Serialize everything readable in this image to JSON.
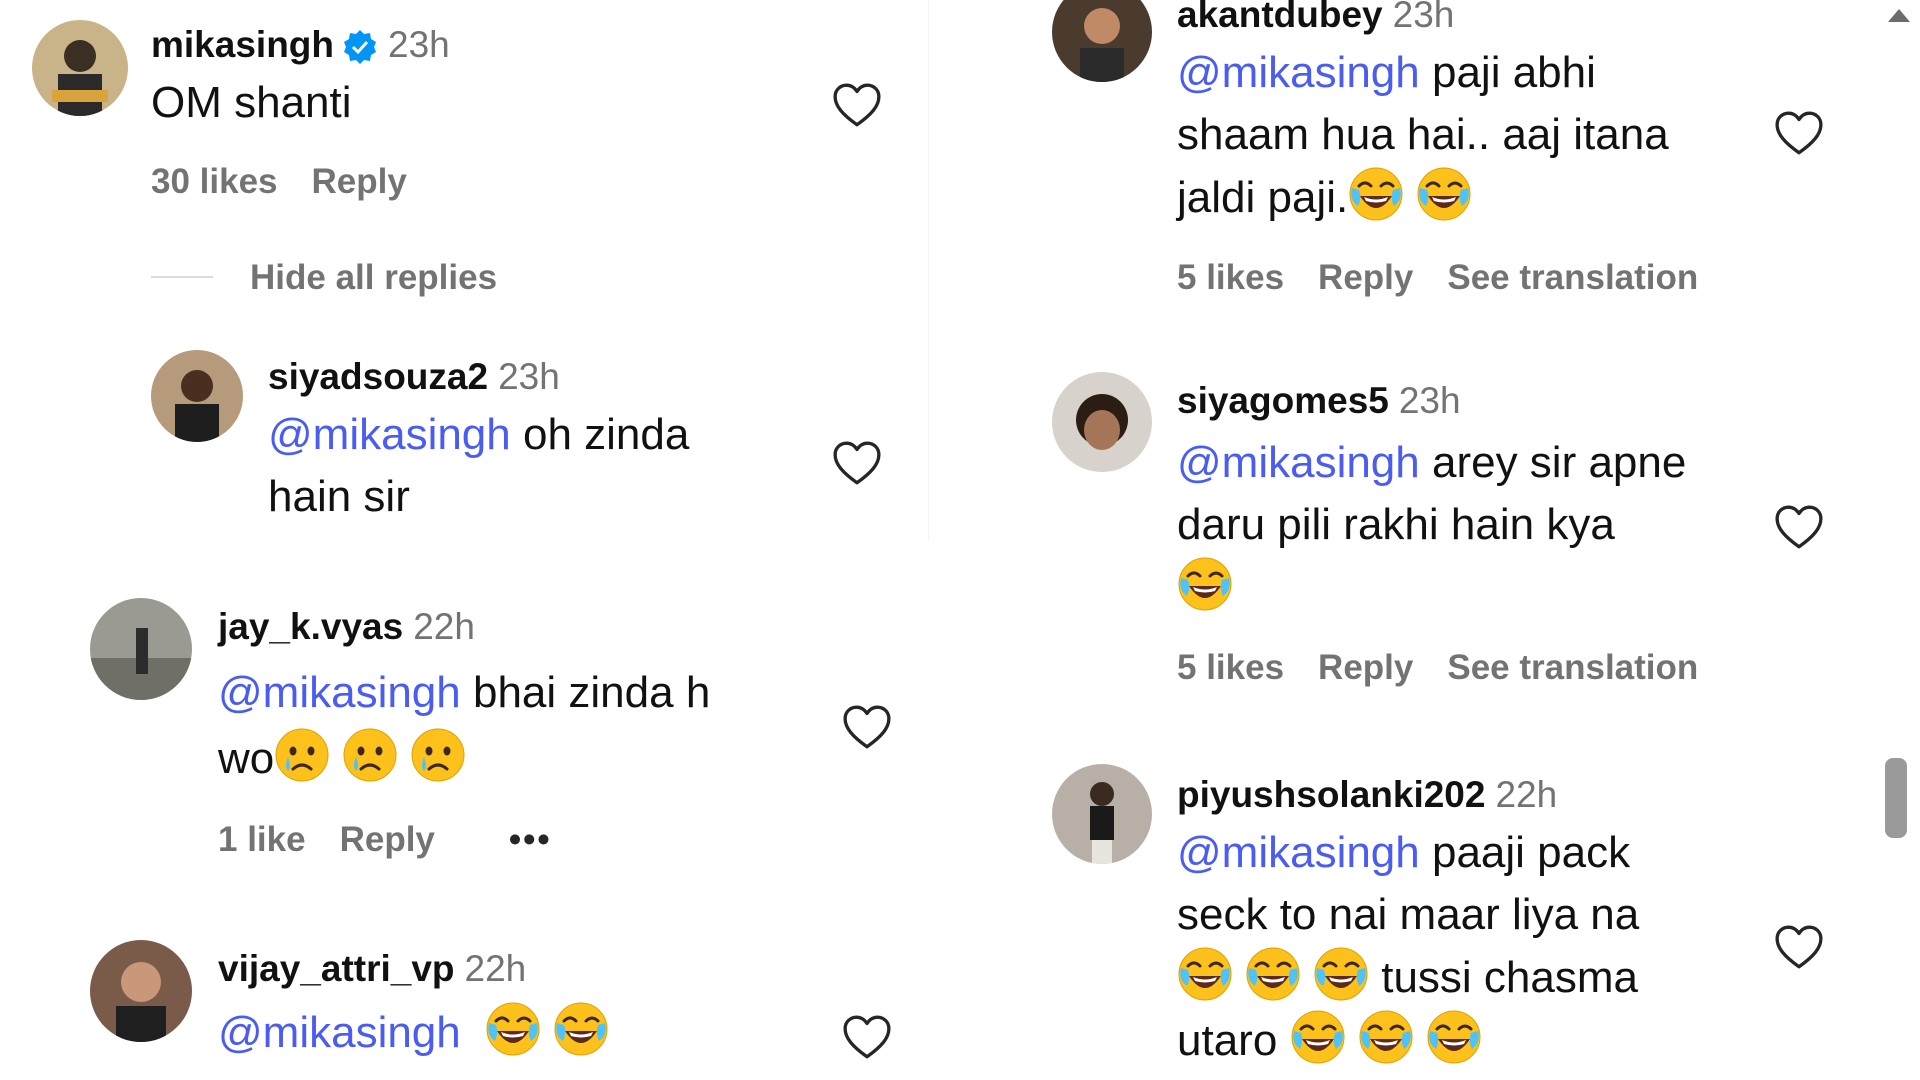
{
  "left": {
    "root_comment": {
      "username": "mikasingh",
      "time": "23h",
      "text": "OM shanti",
      "likes": "30 likes",
      "reply": "Reply",
      "hide_replies": "Hide all replies"
    },
    "reply1": {
      "username": "siyadsouza2",
      "time": "23h",
      "mention": "@mikasingh",
      "text_line1": " oh zinda",
      "text_line2": "hain sir"
    },
    "comment2": {
      "username": "jay_k.vyas",
      "time": "22h",
      "mention": "@mikasingh",
      "text_line1": " bhai zinda h",
      "text_line2": "wo",
      "likes": "1 like",
      "reply": "Reply",
      "more": "•••"
    },
    "comment3": {
      "username": "vijay_attri_vp",
      "time": "22h",
      "mention": "@mikasingh"
    }
  },
  "right": {
    "comment1": {
      "username": "akantdubey",
      "time": "23h",
      "mention": "@mikasingh",
      "text_line1": " paji abhi",
      "text_line2": "shaam hua hai.. aaj itana",
      "text_line3": "jaldi paji.",
      "likes": "5 likes",
      "reply": "Reply",
      "translate": "See translation"
    },
    "comment2": {
      "username": "siyagomes5",
      "time": "23h",
      "mention": "@mikasingh",
      "text_line1": " arey sir apne",
      "text_line2": "daru pili rakhi hain kya",
      "likes": "5 likes",
      "reply": "Reply",
      "translate": "See translation"
    },
    "comment3": {
      "username": "piyushsolanki202",
      "time": "22h",
      "mention": "@mikasingh",
      "text_line1": " paaji pack",
      "text_line2": "seck to nai maar liya na",
      "text_line3": " tussi chasma",
      "text_line4": "utaro "
    }
  },
  "icons": {
    "heart": "heart-outline-icon",
    "verified": "verified-badge-icon",
    "joy": "face-with-tears-of-joy-emoji",
    "cry": "crying-face-emoji"
  },
  "colors": {
    "mention": "#4a5df0",
    "muted": "#737373",
    "verified": "#0095f6"
  }
}
